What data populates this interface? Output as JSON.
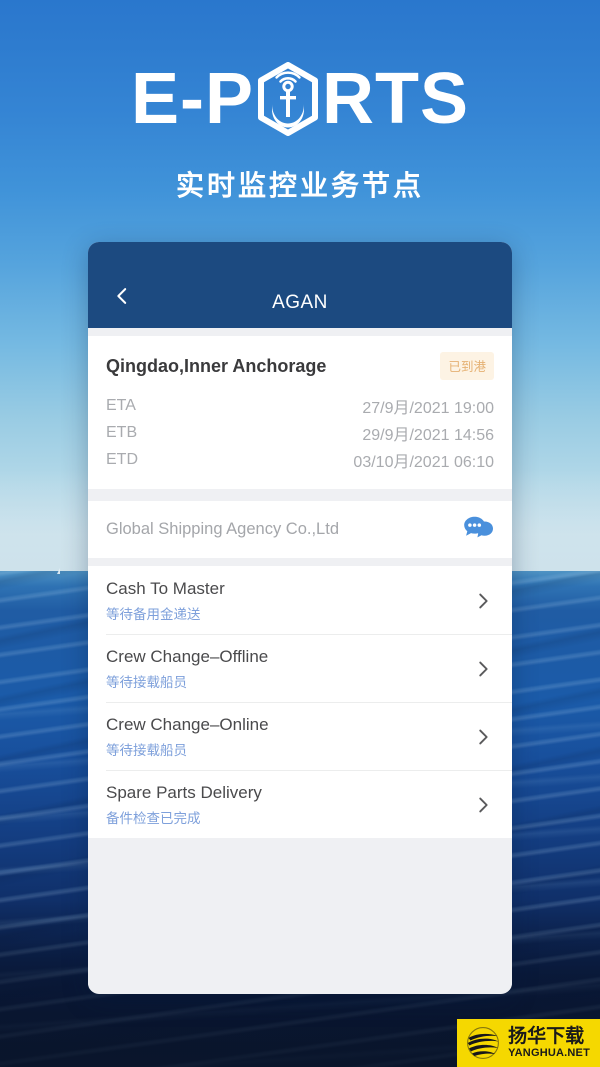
{
  "brand": {
    "logo_prefix": "E-P",
    "logo_suffix": "RTS",
    "logo_mark_icon": "hexagon-anchor-icon",
    "tagline": "实时监控业务节点",
    "sky_top_color": "#2a77cd",
    "sea_bottom_color": "#0c1b31"
  },
  "app": {
    "navbar": {
      "back_icon": "chevron-left-icon",
      "title": "AGAN",
      "bg_color": "#1c4a80"
    },
    "port": {
      "name": "Qingdao,Inner Anchorage",
      "status_badge": "已到港",
      "badge_bg_color": "#fdf3e4",
      "badge_text_color": "#e5b173",
      "schedule": [
        {
          "key": "ETA",
          "value": "27/9月/2021 19:00"
        },
        {
          "key": "ETB",
          "value": "29/9月/2021 14:56"
        },
        {
          "key": "ETD",
          "value": "03/10月/2021 06:10"
        }
      ]
    },
    "agency": {
      "name": "Global Shipping Agency Co.,Ltd",
      "chat_icon": "chat-bubbles-icon",
      "chat_icon_color": "#4a90dc"
    },
    "tasks": [
      {
        "title": "Cash To Master",
        "status": "等待备用金递送",
        "chevron_icon": "chevron-right-icon"
      },
      {
        "title": "Crew Change–Offline",
        "status": "等待接载船员",
        "chevron_icon": "chevron-right-icon"
      },
      {
        "title": "Crew Change–Online",
        "status": "等待接载船员",
        "chevron_icon": "chevron-right-icon"
      },
      {
        "title": "Spare Parts Delivery",
        "status": "备件检查已完成",
        "chevron_icon": "chevron-right-icon"
      }
    ],
    "task_status_color": "#7ea0db"
  },
  "watermark": {
    "cn": "扬华下载",
    "en": "YANGHUA.NET",
    "logo_icon": "globe-swoosh-icon",
    "bg_color": "#f5d800"
  }
}
